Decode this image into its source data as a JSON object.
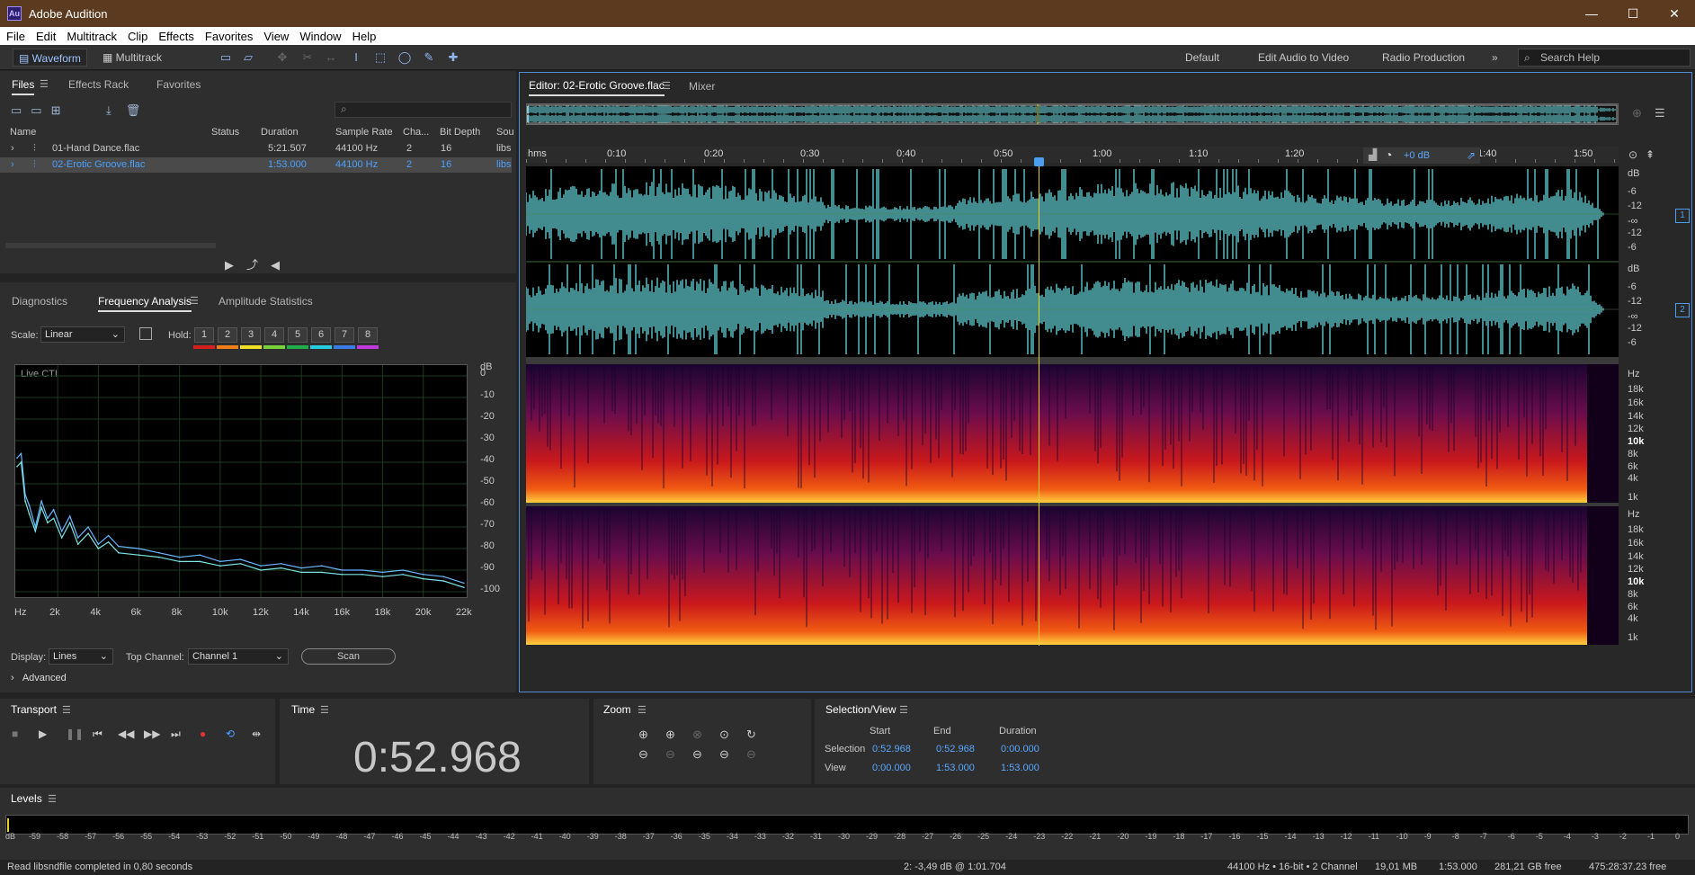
{
  "window": {
    "title": "Adobe Audition",
    "logo": "Au",
    "controls": [
      "—",
      "☐",
      "✕"
    ]
  },
  "menu": [
    "File",
    "Edit",
    "Multitrack",
    "Clip",
    "Effects",
    "Favorites",
    "View",
    "Window",
    "Help"
  ],
  "toolbar": {
    "waveform": "Waveform",
    "multitrack": "Multitrack",
    "workspaces": [
      "Default",
      "Edit Audio to Video",
      "Radio Production"
    ],
    "more": "»",
    "search_placeholder": "Search Help"
  },
  "files_panel": {
    "tabs": [
      "Files",
      "Effects Rack",
      "Favorites"
    ],
    "columns": [
      "Name",
      "Status",
      "Duration",
      "Sample Rate",
      "Cha...",
      "Bit Depth",
      "Sou"
    ],
    "rows": [
      {
        "name": "01-Hand Dance.flac",
        "status": "",
        "duration": "5:21.507",
        "rate": "44100 Hz",
        "channels": "2",
        "bits": "16",
        "source": "libs"
      },
      {
        "name": "02-Erotic Groove.flac",
        "status": "",
        "duration": "1:53.000",
        "rate": "44100 Hz",
        "channels": "2",
        "bits": "16",
        "source": "libs"
      }
    ]
  },
  "analysis_panel": {
    "tabs": [
      "Diagnostics",
      "Frequency Analysis",
      "Amplitude Statistics"
    ],
    "scale_label": "Scale:",
    "scale_value": "Linear",
    "hold_label": "Hold:",
    "hold_buttons": [
      "1",
      "2",
      "3",
      "4",
      "5",
      "6",
      "7",
      "8"
    ],
    "hold_colors": [
      "#d71f1f",
      "#f07d16",
      "#f0e024",
      "#7ad23a",
      "#1fae48",
      "#25cde0",
      "#3a7de8",
      "#c23adf"
    ],
    "live_cti": "Live CTI",
    "display_label": "Display:",
    "display_value": "Lines",
    "top_channel_label": "Top Channel:",
    "top_channel_value": "Channel 1",
    "scan": "Scan",
    "advanced": "Advanced"
  },
  "chart_data": {
    "type": "line",
    "title": "",
    "xlabel": "",
    "ylabel": "",
    "x_ticks": [
      "Hz",
      "2k",
      "4k",
      "6k",
      "8k",
      "10k",
      "12k",
      "14k",
      "16k",
      "18k",
      "20k",
      "22k"
    ],
    "y_ticks": [
      "dB",
      "0",
      "-10",
      "-20",
      "-30",
      "-40",
      "-50",
      "-60",
      "-70",
      "-80",
      "-90",
      "-100"
    ],
    "xlim": [
      0,
      22050
    ],
    "ylim": [
      -100,
      0
    ],
    "series": [
      {
        "channel": 1,
        "x": [
          0,
          200,
          400,
          600,
          900,
          1200,
          1500,
          1800,
          2200,
          2600,
          3000,
          3500,
          4000,
          4500,
          5000,
          6000,
          7000,
          8000,
          9000,
          10000,
          11000,
          12000,
          13000,
          14000,
          15000,
          16000,
          17000,
          18000,
          19000,
          20000,
          21000,
          22000
        ],
        "values": [
          -38,
          -36,
          -55,
          -60,
          -70,
          -58,
          -66,
          -62,
          -72,
          -65,
          -75,
          -70,
          -78,
          -74,
          -79,
          -80,
          -82,
          -84,
          -83,
          -86,
          -85,
          -88,
          -87,
          -89,
          -88,
          -90,
          -90,
          -91,
          -90,
          -92,
          -93,
          -96
        ]
      },
      {
        "channel": 2,
        "x": [
          0,
          200,
          400,
          600,
          900,
          1200,
          1500,
          1800,
          2200,
          2600,
          3000,
          3500,
          4000,
          4500,
          5000,
          6000,
          7000,
          8000,
          9000,
          10000,
          11000,
          12000,
          13000,
          14000,
          15000,
          16000,
          17000,
          18000,
          19000,
          20000,
          21000,
          22000
        ],
        "values": [
          -42,
          -40,
          -58,
          -64,
          -72,
          -61,
          -68,
          -66,
          -75,
          -68,
          -78,
          -73,
          -80,
          -77,
          -82,
          -83,
          -84,
          -86,
          -86,
          -88,
          -87,
          -90,
          -89,
          -91,
          -91,
          -92,
          -92,
          -93,
          -92,
          -94,
          -95,
          -98
        ]
      }
    ]
  },
  "editor": {
    "tab": "Editor: 02-Erotic Groove.flac",
    "mixer": "Mixer",
    "ruler": [
      "hms",
      "0:10",
      "0:20",
      "0:30",
      "0:40",
      "0:50",
      "1:00",
      "1:10",
      "1:20",
      "1:40",
      "1:50"
    ],
    "hud_gain": "+0 dB",
    "db_labels": [
      "dB",
      "-6",
      "-12",
      "-∞",
      "-12",
      "-6"
    ],
    "hz_labels": [
      "Hz",
      "18k",
      "16k",
      "14k",
      "12k",
      "10k",
      "8k",
      "6k",
      "4k",
      "1k"
    ],
    "channels": [
      "1",
      "2"
    ],
    "waveform_color": "#6ee8ee",
    "playhead_color": "#e8d22a"
  },
  "transport": {
    "title": "Transport"
  },
  "time": {
    "title": "Time",
    "value": "0:52.968"
  },
  "zoom": {
    "title": "Zoom"
  },
  "selection_view": {
    "title": "Selection/View",
    "headers": [
      "Start",
      "End",
      "Duration"
    ],
    "selection_label": "Selection",
    "view_label": "View",
    "selection": [
      "0:52.968",
      "0:52.968",
      "0:00.000"
    ],
    "view": [
      "0:00.000",
      "1:53.000",
      "1:53.000"
    ]
  },
  "levels": {
    "title": "Levels",
    "scale": [
      "dB",
      "-59",
      "-58",
      "-57",
      "-56",
      "-55",
      "-54",
      "-53",
      "-52",
      "-51",
      "-50",
      "-49",
      "-48",
      "-47",
      "-46",
      "-45",
      "-44",
      "-43",
      "-42",
      "-41",
      "-40",
      "-39",
      "-38",
      "-37",
      "-36",
      "-35",
      "-34",
      "-33",
      "-32",
      "-31",
      "-30",
      "-29",
      "-28",
      "-27",
      "-26",
      "-25",
      "-24",
      "-23",
      "-22",
      "-21",
      "-20",
      "-19",
      "-18",
      "-17",
      "-16",
      "-15",
      "-14",
      "-13",
      "-12",
      "-11",
      "-10",
      "-9",
      "-8",
      "-7",
      "-6",
      "-5",
      "-4",
      "-3",
      "-2",
      "-1",
      "0"
    ]
  },
  "status": {
    "message": "Read libsndfile completed in 0,80 seconds",
    "cursor": "2: -3,49 dB @ 1:01.704",
    "format": "44100 Hz • 16-bit • 2 Channel",
    "size": "19,01 MB",
    "duration": "1:53.000",
    "free": "281,21 GB free",
    "time_free": "475:28:37.23 free"
  }
}
